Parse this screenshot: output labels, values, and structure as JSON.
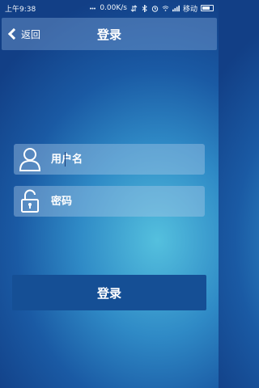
{
  "status_bar": {
    "time": "上午9:38",
    "network_speed": "0.00K/s",
    "carrier": "移动"
  },
  "header": {
    "back_label": "返回",
    "title": "登录"
  },
  "form": {
    "username": {
      "placeholder": "用户名",
      "value": ""
    },
    "password": {
      "placeholder": "密码",
      "value": ""
    },
    "submit_label": "登录"
  },
  "colors": {
    "button": "#154f95",
    "field_bg": "rgba(170,200,230,0.42)",
    "header_bg": "rgba(120,160,210,0.45)"
  }
}
